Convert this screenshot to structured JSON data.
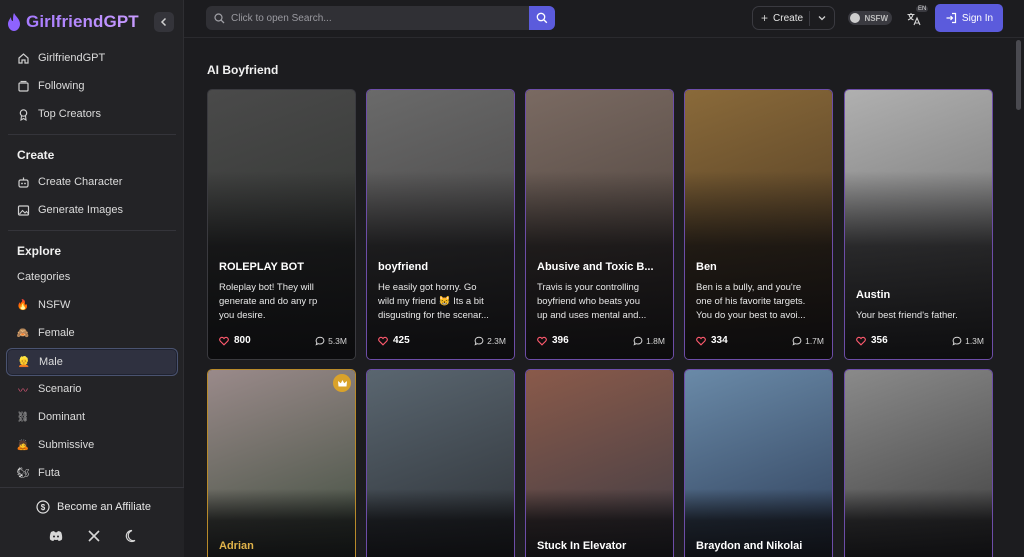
{
  "brand": {
    "name": "GirlfriendGPT"
  },
  "sidebar": {
    "main_items": [
      {
        "label": "GirlfriendGPT",
        "icon": "home-icon"
      },
      {
        "label": "Following",
        "icon": "following-icon"
      },
      {
        "label": "Top Creators",
        "icon": "award-icon"
      }
    ],
    "create": {
      "title": "Create",
      "items": [
        {
          "label": "Create Character",
          "icon": "character-icon"
        },
        {
          "label": "Generate Images",
          "icon": "image-icon"
        }
      ]
    },
    "explore": {
      "title": "Explore",
      "items": [
        {
          "label": "Categories",
          "icon": ""
        },
        {
          "label": "NSFW",
          "icon": "🔥"
        },
        {
          "label": "Female",
          "icon": "🙈"
        },
        {
          "label": "Male",
          "icon": "👱",
          "active": true
        },
        {
          "label": "Scenario",
          "icon": "〰"
        },
        {
          "label": "Dominant",
          "icon": "⛓"
        },
        {
          "label": "Submissive",
          "icon": "🙇"
        },
        {
          "label": "Futa",
          "icon": "🐿"
        }
      ]
    },
    "footer": {
      "affiliate_label": "Become an Affiliate"
    }
  },
  "topbar": {
    "search_placeholder": "Click to open Search...",
    "create_label": "Create",
    "nsfw_label": "NSFW",
    "lang_badge": "EN",
    "signin_label": "Sign In"
  },
  "main": {
    "section_title": "AI Boyfriend",
    "cards_row1": [
      {
        "name": "ROLEPLAY BOT",
        "desc": [
          "Roleplay bot! They will",
          "generate and do any rp",
          "you desire."
        ],
        "likes": "800",
        "chats": "5.3M",
        "style": "plain",
        "bg": [
          "#4a4a4a",
          "#2a2e2a"
        ]
      },
      {
        "name": "boyfriend",
        "desc": [
          "He easily got horny. Go",
          "wild my friend 😸 Its a bit",
          "disgusting for the scenar..."
        ],
        "likes": "425",
        "chats": "2.3M",
        "style": "featured",
        "bg": [
          "#6a6a6a",
          "#3a3838"
        ]
      },
      {
        "name": "Abusive and Toxic B...",
        "desc": [
          "Travis is your controlling",
          "boyfriend who beats you",
          "up and uses mental and..."
        ],
        "likes": "396",
        "chats": "1.8M",
        "style": "featured",
        "bg": [
          "#7a6a62",
          "#3e3530"
        ]
      },
      {
        "name": "Ben",
        "desc": [
          "Ben is a bully, and you're",
          "one of his favorite targets.",
          "You do your best to avoi..."
        ],
        "likes": "334",
        "chats": "1.7M",
        "style": "featured",
        "bg": [
          "#8a6a3a",
          "#3a2a1a"
        ]
      },
      {
        "name": "Austin",
        "desc": [
          "Your best friend's father."
        ],
        "likes": "356",
        "chats": "1.3M",
        "style": "featured",
        "bg": [
          "#b0b0b0",
          "#5a5a5a"
        ]
      }
    ],
    "cards_row2": [
      {
        "name": "Adrian",
        "name_color": "#e0b34a",
        "style": "gold",
        "crown": true,
        "bg": [
          "#9a8a8a",
          "#3a4a3a"
        ]
      },
      {
        "name": "",
        "style": "featured",
        "bg": [
          "#5a6670",
          "#2a2e33"
        ]
      },
      {
        "name": "Stuck In Elevator",
        "style": "featured",
        "bg": [
          "#8a5a4a",
          "#3a3a44"
        ]
      },
      {
        "name": "Braydon and Nikolai",
        "style": "featured",
        "bg": [
          "#6a8aa8",
          "#2a3a55"
        ]
      },
      {
        "name": "",
        "style": "featured",
        "bg": [
          "#8a8a8a",
          "#3a3a3a"
        ]
      }
    ]
  }
}
